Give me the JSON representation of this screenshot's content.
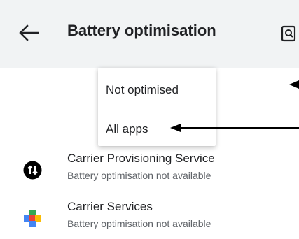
{
  "app_bar": {
    "back_icon": "arrow-back-icon",
    "title": "Battery optimisation",
    "search_icon": "search-settings-icon"
  },
  "dropdown": {
    "options": [
      {
        "label": "Not optimised"
      },
      {
        "label": "All apps"
      }
    ]
  },
  "apps": [
    {
      "name": "Carrier Provisioning Service",
      "status": "Battery optimisation not available",
      "icon": "carrier-provisioning-icon"
    },
    {
      "name": "Carrier Services",
      "status": "Battery optimisation not available",
      "icon": "carrier-services-icon"
    }
  ],
  "colors": {
    "app_bar_bg": "#f1f3f4",
    "primary_text": "#202124",
    "secondary_text": "#5f6368"
  }
}
